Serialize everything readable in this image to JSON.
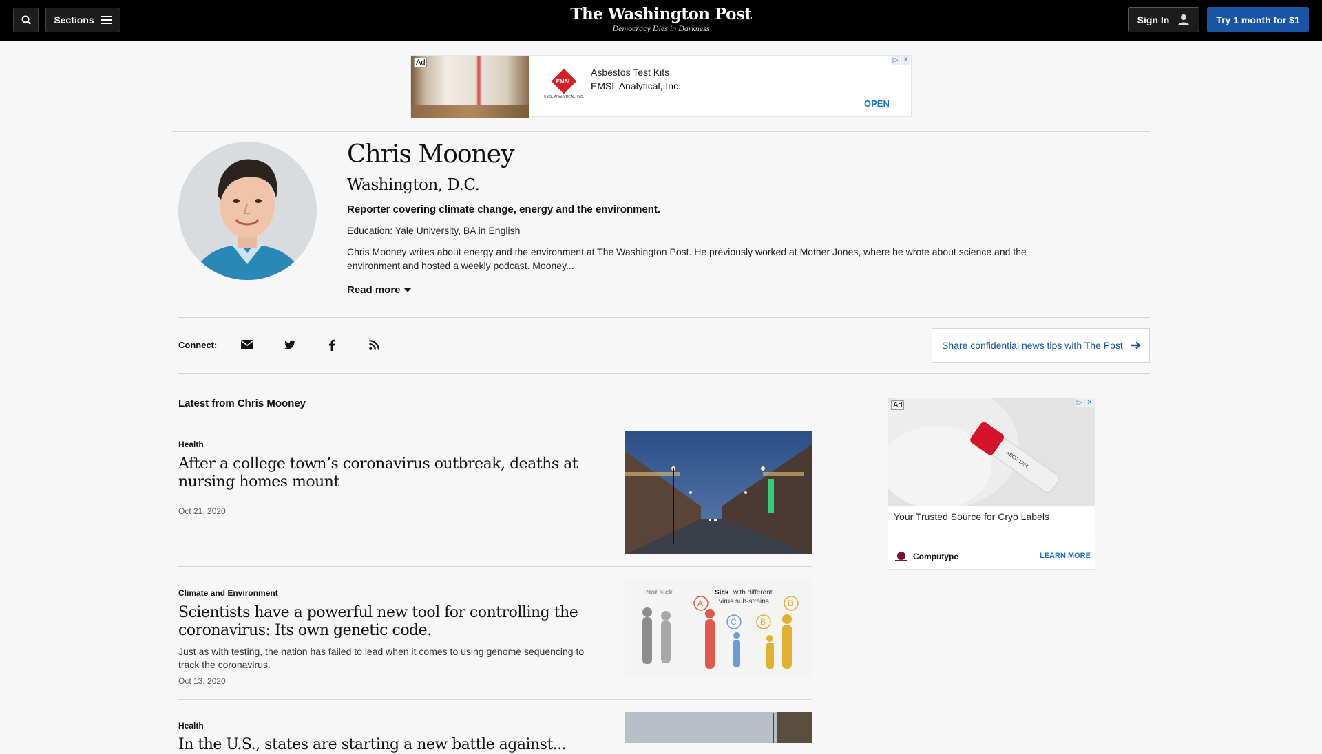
{
  "header": {
    "sections_label": "Sections",
    "logo": "The Washington Post",
    "tagline": "Democracy Dies in Darkness",
    "signin_label": "Sign In",
    "trial_label": "Try 1 month for $1"
  },
  "ad_top": {
    "ad_badge": "Ad",
    "line1": "Asbestos Test Kits",
    "line2": "EMSL Analytical, Inc.",
    "cta": "OPEN",
    "logo_text": "EMSL",
    "logo_sub": "EMSL ANALYTICAL, INC."
  },
  "author": {
    "name": "Chris Mooney",
    "location": "Washington, D.C.",
    "role": "Reporter covering climate change, energy and the environment.",
    "education": "Education: Yale University, BA in English",
    "bio": "Chris Mooney writes about energy and the environment at The Washington Post. He previously worked at Mother Jones, where he wrote about science and the environment and hosted a weekly podcast. Mooney...",
    "read_more": "Read more"
  },
  "connect": {
    "label": "Connect:",
    "tips": "Share confidential news tips with The Post"
  },
  "feed": {
    "heading": "Latest from Chris Mooney",
    "articles": [
      {
        "kicker": "Health",
        "headline": "After a college town’s coronavirus outbreak, deaths at nursing homes mount",
        "blurb": "",
        "date": "Oct 21, 2020"
      },
      {
        "kicker": "Climate and Environment",
        "headline": "Scientists have a powerful new tool for controlling the coronavirus: Its own genetic code.",
        "blurb": "Just as with testing, the nation has failed to lead when it comes to using genome sequencing to track the coronavirus.",
        "date": "Oct 13, 2020",
        "graphic": {
          "not_sick": "Not sick",
          "sick": "Sick",
          "sick_rest": "with different",
          "sick_rest2": "virus sub-strains",
          "a": "A",
          "b": "B",
          "c": "C"
        }
      },
      {
        "kicker": "Health",
        "headline": "In the U.S., states are starting a new battle against...",
        "blurb": "",
        "date": ""
      }
    ]
  },
  "ad_side": {
    "ad_badge": "Ad",
    "title": "Your Trusted Source for Cryo Labels",
    "brand": "Computype",
    "cta": "LEARN MORE"
  },
  "colors": {
    "accent": "#1955a5",
    "ad_link": "#1a73c6"
  }
}
